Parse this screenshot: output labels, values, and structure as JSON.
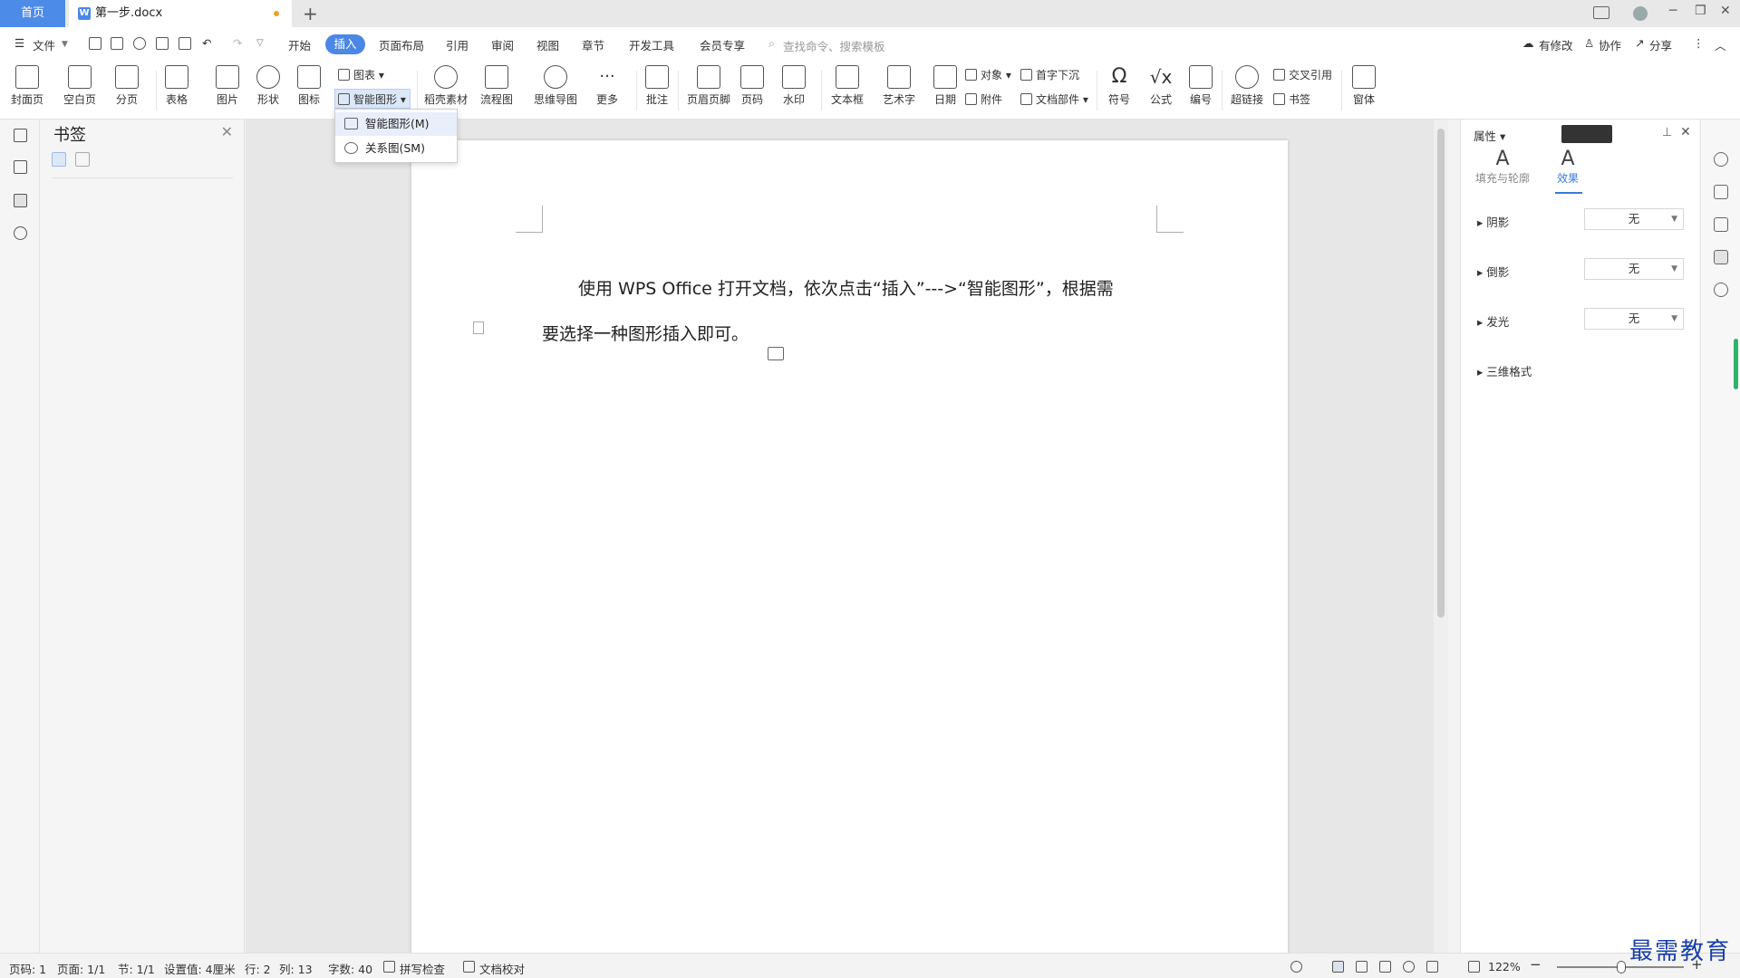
{
  "titlebar": {
    "home_tab": "首页",
    "doc_tab": "第一步.docx",
    "new_tab": "+",
    "window_controls": [
      "─",
      "❐",
      "✕"
    ]
  },
  "menubar": {
    "file": "文件",
    "tabs": [
      "开始",
      "插入",
      "页面布局",
      "引用",
      "审阅",
      "视图",
      "章节",
      "开发工具",
      "会员专享"
    ],
    "active_tab": "插入",
    "search_placeholder": "查找命令、搜索模板",
    "right": [
      "有修改",
      "协作",
      "分享"
    ]
  },
  "ribbon": {
    "buttons": [
      "封面页",
      "空白页",
      "分页",
      "表格",
      "图片",
      "形状",
      "图标",
      "稻壳素材",
      "流程图",
      "思维导图",
      "更多",
      "批注",
      "页眉页脚",
      "页码",
      "水印",
      "文本框",
      "艺术字",
      "日期",
      "符号",
      "公式",
      "编号",
      "超链接",
      "窗体"
    ],
    "small": {
      "chart": "图表",
      "smartart": "智能图形",
      "object": "对象",
      "dropcap": "首字下沉",
      "attachment": "附件",
      "docpart": "文档部件",
      "crossref": "交叉引用",
      "bookmark": "书签"
    }
  },
  "dropdown": {
    "items": [
      "智能图形(M)",
      "关系图(SM)"
    ]
  },
  "bookmark_pane": {
    "title": "书签",
    "close": "✕"
  },
  "document": {
    "line1": "使用 WPS Office 打开文档，依次点击“插入”--->“智能图形”，根据需",
    "line2": "要选择一种图形插入即可。"
  },
  "properties": {
    "header": "属性",
    "tabs": [
      "填充与轮廓",
      "效果"
    ],
    "active_tab": "效果",
    "rows": [
      {
        "label": "阴影",
        "value": "无"
      },
      {
        "label": "倒影",
        "value": "无"
      },
      {
        "label": "发光",
        "value": "无"
      },
      {
        "label": "三维格式",
        "value": ""
      }
    ]
  },
  "statusbar": {
    "page": "页码: 1",
    "pages": "页面: 1/1",
    "section": "节: 1/1",
    "setting": "设置值: 4厘米",
    "row": "行: 2",
    "col": "列: 13",
    "words": "字数: 40",
    "spellcheck": "拼写检查",
    "proof": "文档校对",
    "zoom": "122%"
  },
  "watermark": "最需教育",
  "colors": {
    "accent": "#4b87e5",
    "active_tab_text": "#3a7bdc",
    "modified_dot": "#f0a020",
    "green_indicator": "#2fb36a"
  }
}
